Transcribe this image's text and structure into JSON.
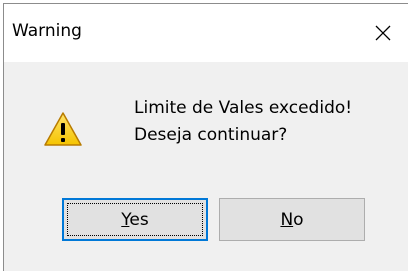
{
  "window": {
    "title": "Warning",
    "close_icon": "close-icon"
  },
  "icon": {
    "name": "warning-icon",
    "fill_color": "#fcd116",
    "stroke_color": "#b87b00"
  },
  "message": {
    "line1": "Limite de Vales excedido!",
    "line2": "Deseja continuar?"
  },
  "buttons": {
    "yes": {
      "mnemonic": "Y",
      "rest": "es"
    },
    "no": {
      "mnemonic": "N",
      "rest": "o"
    }
  },
  "colors": {
    "dialog_background": "#f0f0f0",
    "title_background": "#ffffff",
    "default_button_border": "#0078d7",
    "button_background": "#e1e1e1"
  }
}
